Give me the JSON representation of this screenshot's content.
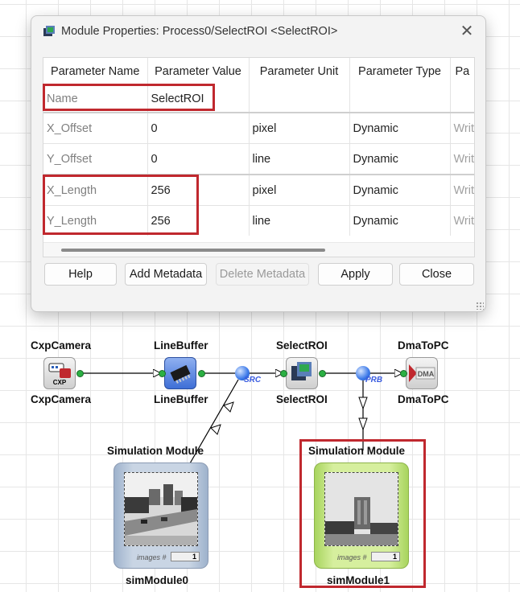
{
  "dialog": {
    "title": "Module Properties: Process0/SelectROI <SelectROI>",
    "columns": [
      "Parameter Name",
      "Parameter Value",
      "Parameter Unit",
      "Parameter Type",
      "Pa"
    ],
    "name_row": {
      "name": "Name",
      "value": "SelectROI"
    },
    "rows": [
      {
        "name": "X_Offset",
        "value": "0",
        "unit": "pixel",
        "type": "Dynamic",
        "access": "Writ"
      },
      {
        "name": "Y_Offset",
        "value": "0",
        "unit": "line",
        "type": "Dynamic",
        "access": "Writ"
      },
      {
        "name": "X_Length",
        "value": "256",
        "unit": "pixel",
        "type": "Dynamic",
        "access": "Writ"
      },
      {
        "name": "Y_Length",
        "value": "256",
        "unit": "line",
        "type": "Dynamic",
        "access": "Writ"
      }
    ],
    "buttons": {
      "help": "Help",
      "add_metadata": "Add Metadata",
      "delete_metadata": "Delete Metadata",
      "apply": "Apply",
      "close": "Close"
    },
    "highlight_color": "#c0282e"
  },
  "pipeline": {
    "cxp": {
      "label_top": "CxpCamera",
      "label_bottom": "CxpCamera",
      "icon_text": "CXP"
    },
    "linebuffer": {
      "label_top": "LineBuffer",
      "label_bottom": "LineBuffer"
    },
    "selectroi": {
      "label_top": "SelectROI",
      "label_bottom": "SelectROI"
    },
    "dma": {
      "label_top": "DmaToPC",
      "label_bottom": "DmaToPC",
      "icon_text": "DMA"
    },
    "src_port": "SRC",
    "prb_port": "PRB",
    "sim0": {
      "label_top": "Simulation Module",
      "label_bottom": "simModule0",
      "images_label": "images #",
      "count": "1",
      "color": "blue"
    },
    "sim1": {
      "label_top": "Simulation Module",
      "label_bottom": "simModule1",
      "images_label": "images #",
      "count": "1",
      "color": "green"
    }
  }
}
